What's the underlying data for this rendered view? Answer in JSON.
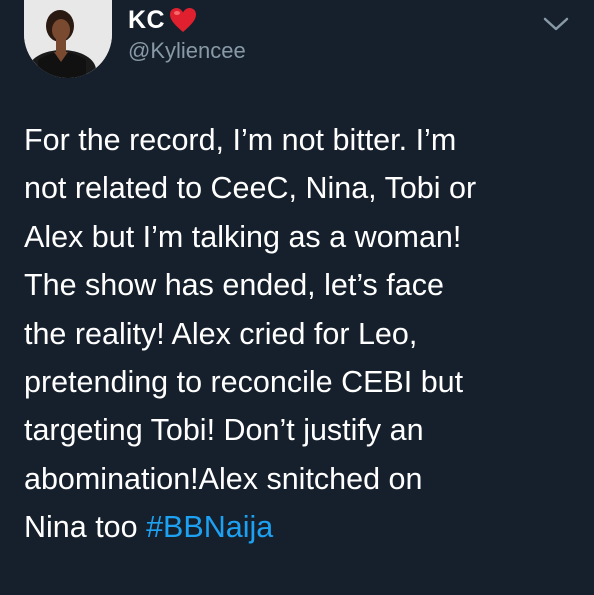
{
  "header": {
    "display_name": "KC",
    "handle": "@Kyliencee"
  },
  "icons": {
    "avatar": "profile-photo",
    "heart": "red-heart-icon",
    "more": "chevron-down-icon"
  },
  "colors": {
    "background": "#16202c",
    "text": "#ffffff",
    "secondary": "#8899a6",
    "link": "#1da1f2",
    "heart": "#e0202e"
  },
  "tweet": {
    "lines": [
      "For the record, I’m not bitter. I’m",
      "not related to CeeC, Nina, Tobi or",
      "Alex but I’m talking as a woman!",
      "The show has ended, let’s face",
      "the reality! Alex cried for Leo,",
      "pretending to reconcile CEBI but",
      "targeting Tobi! Don’t justify an",
      "abomination!Alex snitched on"
    ],
    "last_line_text": "Nina too ",
    "hashtag": "#BBNaija"
  }
}
